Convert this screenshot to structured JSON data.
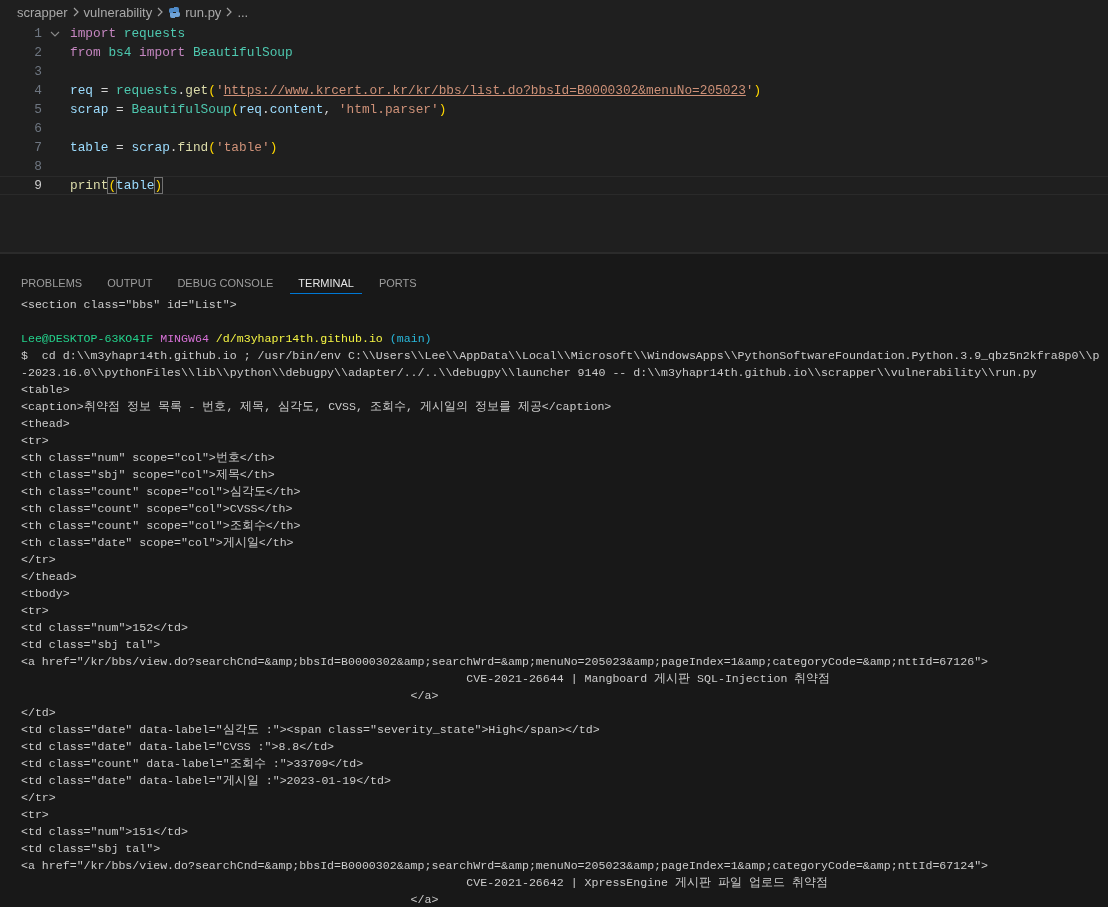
{
  "breadcrumb": [
    {
      "label": "scrapper",
      "kind": "folder"
    },
    {
      "label": "vulnerability",
      "kind": "folder"
    },
    {
      "label": "run.py",
      "kind": "file"
    },
    {
      "label": "...",
      "kind": "more"
    }
  ],
  "editor": {
    "lines": [
      {
        "number": "1",
        "selected": false,
        "foldable": true,
        "tokens": [
          {
            "text": "import",
            "kind": "kw"
          },
          {
            "text": " requests",
            "kind": "mod"
          }
        ]
      },
      {
        "number": "2",
        "selected": false,
        "tokens": [
          {
            "text": "from",
            "kind": "kw"
          },
          {
            "text": " bs4",
            "kind": "mod"
          },
          {
            "text": " import",
            "kind": "kw"
          },
          {
            "text": " BeautifulSoup",
            "kind": "mod"
          }
        ]
      },
      {
        "number": "3",
        "selected": false
      },
      {
        "number": "4",
        "selected": false,
        "tokens": [
          {
            "text": "req",
            "kind": "var"
          },
          {
            "text": " = ",
            "kind": "punc"
          },
          {
            "text": "requests",
            "kind": "mod"
          },
          {
            "text": ".",
            "kind": "punc"
          },
          {
            "text": "get",
            "kind": "fn"
          },
          {
            "text": "(",
            "kind": "bracket"
          },
          {
            "text": "'",
            "kind": "str"
          },
          {
            "text": "https://www.krcert.or.kr/kr/bbs/list.do?bbsId=B0000302&menuNo=205023",
            "kind": "url"
          },
          {
            "text": "'",
            "kind": "str"
          },
          {
            "text": ")",
            "kind": "bracket"
          }
        ]
      },
      {
        "number": "5",
        "selected": false,
        "tokens": [
          {
            "text": "scrap",
            "kind": "var"
          },
          {
            "text": " = ",
            "kind": "punc"
          },
          {
            "text": "BeautifulSoup",
            "kind": "mod"
          },
          {
            "text": "(",
            "kind": "bracket"
          },
          {
            "text": "req",
            "kind": "var"
          },
          {
            "text": ".",
            "kind": "punc"
          },
          {
            "text": "content",
            "kind": "var"
          },
          {
            "text": ", ",
            "kind": "punc"
          },
          {
            "text": "'html.parser'",
            "kind": "str"
          },
          {
            "text": ")",
            "kind": "bracket"
          }
        ]
      },
      {
        "number": "6",
        "selected": false
      },
      {
        "number": "7",
        "selected": false,
        "tokens": [
          {
            "text": "table",
            "kind": "var"
          },
          {
            "text": " = ",
            "kind": "punc"
          },
          {
            "text": "scrap",
            "kind": "var"
          },
          {
            "text": ".",
            "kind": "punc"
          },
          {
            "text": "find",
            "kind": "fn"
          },
          {
            "text": "(",
            "kind": "bracket"
          },
          {
            "text": "'table'",
            "kind": "str"
          },
          {
            "text": ")",
            "kind": "bracket"
          }
        ]
      },
      {
        "number": "8",
        "selected": false
      },
      {
        "number": "9",
        "selected": true,
        "tokens": [
          {
            "text": "print",
            "kind": "fn"
          },
          {
            "text": "(",
            "kind": "bracket-match"
          },
          {
            "text": "table",
            "kind": "var"
          },
          {
            "text": ")",
            "kind": "bracket-match"
          }
        ]
      }
    ]
  },
  "panel": {
    "tabs": [
      {
        "label": "PROBLEMS",
        "selected": false
      },
      {
        "label": "OUTPUT",
        "selected": false
      },
      {
        "label": "DEBUG CONSOLE",
        "selected": false
      },
      {
        "label": "TERMINAL",
        "selected": true
      },
      {
        "label": "PORTS",
        "selected": false
      }
    ],
    "terminal": {
      "lines": [
        {
          "kind": "output",
          "text": "<section class=\"bbs\" id=\"List\">"
        },
        {
          "kind": "blank"
        },
        {
          "kind": "prompt",
          "segments": [
            {
              "text": "Lee@DESKTOP-63KO4IF",
              "kind": "user"
            },
            {
              "text": "MINGW64",
              "kind": "shell"
            },
            {
              "text": "/d/m3yhapr14th.github.io",
              "kind": "path"
            },
            {
              "text": "(main)",
              "kind": "branch"
            }
          ]
        },
        {
          "kind": "output",
          "text": "$  cd d:\\\\m3yhapr14th.github.io ; /usr/bin/env C:\\\\Users\\\\Lee\\\\AppData\\\\Local\\\\Microsoft\\\\WindowsApps\\\\PythonSoftwareFoundation.Python.3.9_qbz5n2kfra8p0\\\\p"
        },
        {
          "kind": "output",
          "text": "-2023.16.0\\\\pythonFiles\\\\lib\\\\python\\\\debugpy\\\\adapter/../..\\\\debugpy\\\\launcher 9140 -- d:\\\\m3yhapr14th.github.io\\\\scrapper\\\\vulnerability\\\\run.py"
        },
        {
          "kind": "output",
          "text": "<table>"
        },
        {
          "kind": "output",
          "text": "<caption>취약점 정보 목록 - 번호, 제목, 심각도, CVSS, 조회수, 게시일의 정보를 제공</caption>"
        },
        {
          "kind": "output",
          "text": "<thead>"
        },
        {
          "kind": "output",
          "text": "<tr>"
        },
        {
          "kind": "output",
          "text": "<th class=\"num\" scope=\"col\">번호</th>"
        },
        {
          "kind": "output",
          "text": "<th class=\"sbj\" scope=\"col\">제목</th>"
        },
        {
          "kind": "output",
          "text": "<th class=\"count\" scope=\"col\">심각도</th>"
        },
        {
          "kind": "output",
          "text": "<th class=\"count\" scope=\"col\">CVSS</th>"
        },
        {
          "kind": "output",
          "text": "<th class=\"count\" scope=\"col\">조회수</th>"
        },
        {
          "kind": "output",
          "text": "<th class=\"date\" scope=\"col\">게시일</th>"
        },
        {
          "kind": "output",
          "text": "</tr>"
        },
        {
          "kind": "output",
          "text": "</thead>"
        },
        {
          "kind": "output",
          "text": "<tbody>"
        },
        {
          "kind": "output",
          "text": "<tr>"
        },
        {
          "kind": "output",
          "text": "<td class=\"num\">152</td>"
        },
        {
          "kind": "output",
          "text": "<td class=\"sbj tal\">"
        },
        {
          "kind": "output",
          "text": "<a href=\"/kr/bbs/view.do?searchCnd=&amp;bbsId=B0000302&amp;searchWrd=&amp;menuNo=205023&amp;pageIndex=1&amp;categoryCode=&amp;nttId=67126\">"
        },
        {
          "kind": "output",
          "text": "                                                                CVE-2021-26644 | Mangboard 게시판 SQL-Injection 취약점"
        },
        {
          "kind": "output",
          "text": "                                                        </a>"
        },
        {
          "kind": "output",
          "text": "</td>"
        },
        {
          "kind": "output",
          "text": "<td class=\"date\" data-label=\"심각도 :\"><span class=\"severity_state\">High</span></td>"
        },
        {
          "kind": "output",
          "text": "<td class=\"date\" data-label=\"CVSS :\">8.8</td>"
        },
        {
          "kind": "output",
          "text": "<td class=\"count\" data-label=\"조회수 :\">33709</td>"
        },
        {
          "kind": "output",
          "text": "<td class=\"date\" data-label=\"게시일 :\">2023-01-19</td>"
        },
        {
          "kind": "output",
          "text": "</tr>"
        },
        {
          "kind": "output",
          "text": "<tr>"
        },
        {
          "kind": "output",
          "text": "<td class=\"num\">151</td>"
        },
        {
          "kind": "output",
          "text": "<td class=\"sbj tal\">"
        },
        {
          "kind": "output",
          "text": "<a href=\"/kr/bbs/view.do?searchCnd=&amp;bbsId=B0000302&amp;searchWrd=&amp;menuNo=205023&amp;pageIndex=1&amp;categoryCode=&amp;nttId=67124\">"
        },
        {
          "kind": "output",
          "text": "                                                                CVE-2021-26642 | XpressEngine 게시판 파일 업로드 취약점"
        },
        {
          "kind": "output",
          "text": "                                                        </a>"
        }
      ]
    }
  }
}
